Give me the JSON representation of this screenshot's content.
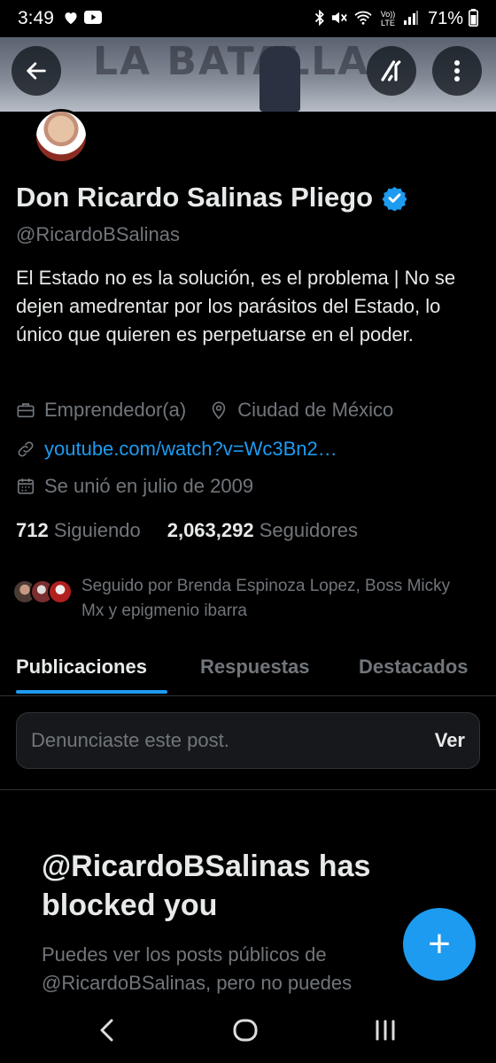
{
  "status_bar": {
    "time": "3:49",
    "left_icons": [
      "heart-icon",
      "youtube-icon"
    ],
    "right_icons": [
      "bluetooth-icon",
      "mute-icon",
      "wifi-icon",
      "volte-icon",
      "signal-icon",
      "battery-icon"
    ],
    "volte_label": "Vo)) LTE",
    "battery": "71%"
  },
  "banner": {
    "wordmark": "LA BATALLA"
  },
  "profile": {
    "name": "Don Ricardo Salinas Pliego",
    "handle": "@RicardoBSalinas",
    "bio": "El Estado no es la solución, es el problema | No se dejen amedrentar por los parásitos del Estado, lo único que quieren es perpetuarse en el poder.",
    "category": "Emprendedor(a)",
    "location": "Ciudad de México",
    "website": "youtube.com/watch?v=Wc3Bn2…",
    "joined": "Se unió en julio de 2009",
    "following_count": "712",
    "following_label": "Siguiendo",
    "followers_count": "2,063,292",
    "followers_label": "Seguidores",
    "followed_by": "Seguido por Brenda Espinoza Lopez, Boss Micky Mx y epigmenio ibarra"
  },
  "tabs": [
    {
      "label": "Publicaciones",
      "active": true
    },
    {
      "label": "Respuestas",
      "active": false
    },
    {
      "label": "Destacados",
      "active": false
    }
  ],
  "notice": {
    "text": "Denunciaste este post.",
    "button": "Ver"
  },
  "blocked": {
    "title": "@RicardoBSalinas has blocked you",
    "body": "Puedes ver los posts públicos de @RicardoBSalinas, pero no puedes"
  },
  "fab_label": "+",
  "colors": {
    "accent": "#1d9bf0",
    "background": "#000000",
    "text_primary": "#e7e9ea",
    "text_secondary": "#71767b"
  }
}
